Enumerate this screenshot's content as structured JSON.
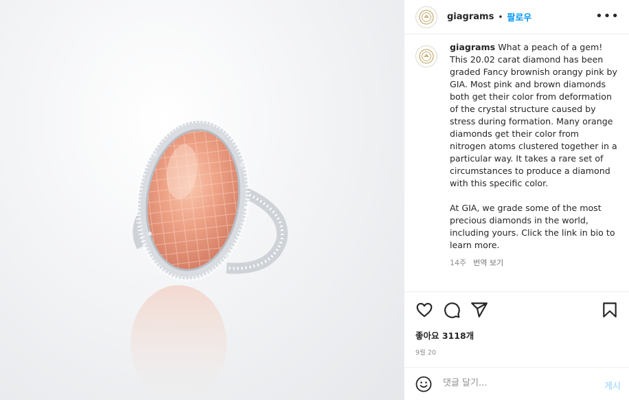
{
  "post": {
    "username": "giagrams",
    "separator": "•",
    "follow_label": "팔로우",
    "more_label": "•••",
    "caption_user": "giagrams",
    "caption_text": "What a peach of a gem! This 20.02 carat diamond has been graded Fancy brownish orangy pink by GIA. Most pink and brown diamonds both get their color from deformation of the crystal structure caused by stress during formation. Many orange diamonds get their color from nitrogen atoms clustered together in a particular way. It takes a rare set of circumstances to produce a diamond with this specific color.\n\nAt GIA, we grade some of the most precious diamonds in the world, including yours. Click the link in bio to learn more.",
    "time_ago": "14주",
    "translate_label": "번역 보기",
    "likes_text": "좋아요 3118개",
    "date_text": "9월 20",
    "comment_placeholder": "댓글 달기...",
    "post_button": "게시"
  },
  "icons": {
    "avatar": "gia-logo-icon",
    "like": "heart-icon",
    "comment": "comment-icon",
    "share": "send-icon",
    "save": "bookmark-icon",
    "emoji": "smiley-icon"
  },
  "colors": {
    "follow": "#0095f6",
    "post_button": "#b2dffc",
    "muted": "#8e8e8e"
  }
}
